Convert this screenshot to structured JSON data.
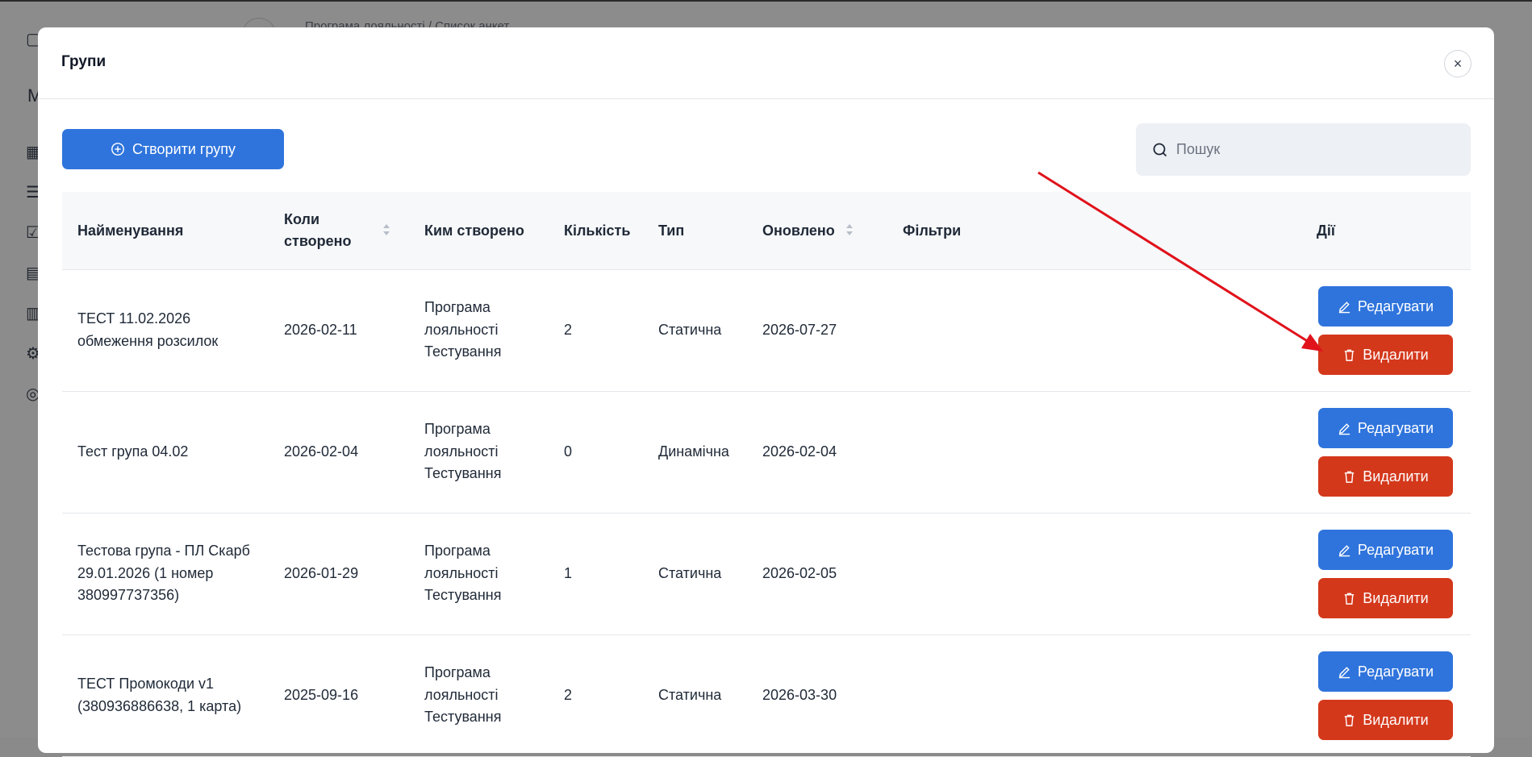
{
  "background": {
    "breadcrumb": "Програма лояльності / Список анкет",
    "sidebar_letter": "М"
  },
  "modal": {
    "title": "Групи",
    "close_label": "×",
    "create_button_label": "Створити групу",
    "search_placeholder": "Пошук"
  },
  "table": {
    "headers": {
      "name": "Найменування",
      "created_line1": "Коли",
      "created_line2": "створено",
      "author": "Ким створено",
      "count": "Кількість",
      "type": "Тип",
      "updated": "Оновлено",
      "filters": "Фільтри",
      "actions": "Дії"
    },
    "edit_label": "Редагувати",
    "delete_label": "Видалити",
    "rows": [
      {
        "name_line1": "ТЕСТ 11.02.2026",
        "name_line2": "обмеження розсилок",
        "name_line3": "",
        "created": "2026-02-11",
        "author_line1": "Програма",
        "author_line2": "лояльності",
        "author_line3": "Тестування",
        "count": "2",
        "type": "Статична",
        "updated": "2026-07-27"
      },
      {
        "name_line1": "Тест група 04.02",
        "name_line2": "",
        "name_line3": "",
        "created": "2026-02-04",
        "author_line1": "Програма",
        "author_line2": "лояльності",
        "author_line3": "Тестування",
        "count": "0",
        "type": "Динамічна",
        "updated": "2026-02-04"
      },
      {
        "name_line1": "Тестова група - ПЛ Скарб",
        "name_line2": "29.01.2026 (1 номер",
        "name_line3": "380997737356)",
        "created": "2026-01-29",
        "author_line1": "Програма",
        "author_line2": "лояльності",
        "author_line3": "Тестування",
        "count": "1",
        "type": "Статична",
        "updated": "2026-02-05"
      },
      {
        "name_line1": "ТЕСТ Промокоди v1",
        "name_line2": "(380936886638, 1 карта)",
        "name_line3": "",
        "created": "2025-09-16",
        "author_line1": "Програма",
        "author_line2": "лояльності",
        "author_line3": "Тестування",
        "count": "2",
        "type": "Статична",
        "updated": "2026-03-30"
      }
    ]
  },
  "colors": {
    "primary": "#2f74dc",
    "danger": "#d4381b",
    "annotation_arrow": "#e0121b"
  }
}
